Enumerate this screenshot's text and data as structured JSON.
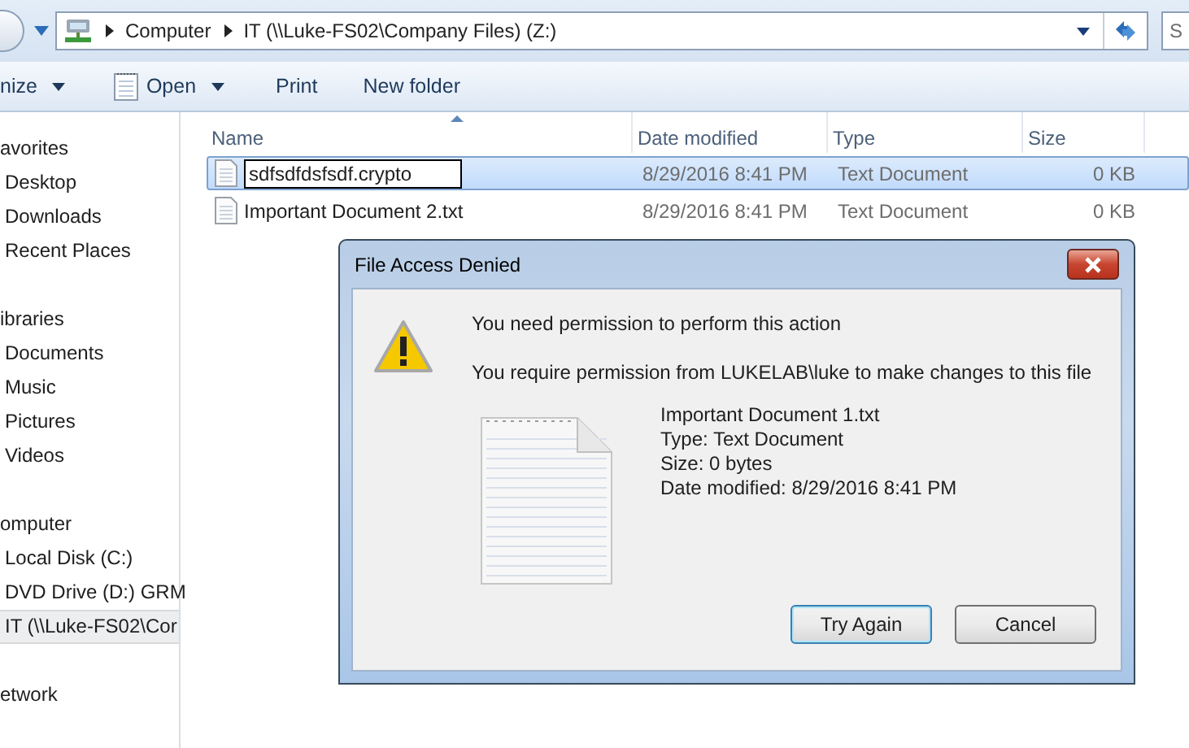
{
  "address_bar": {
    "path": [
      {
        "label": "Computer"
      },
      {
        "label": "IT (\\\\Luke-FS02\\Company Files) (Z:)"
      }
    ],
    "search_placeholder": "S"
  },
  "toolbar": [
    {
      "label": "nize",
      "dropdown": true
    },
    {
      "label": "Open",
      "dropdown": true,
      "kind": "icon"
    },
    {
      "label": "Print",
      "dropdown": false
    },
    {
      "label": "New folder",
      "dropdown": false
    }
  ],
  "sidebar": {
    "groups": [
      {
        "label": "avorites",
        "items": [
          {
            "label": "Desktop",
            "selected": false
          },
          {
            "label": "Downloads",
            "selected": false
          },
          {
            "label": "Recent Places",
            "selected": false
          }
        ]
      },
      {
        "label": "ibraries",
        "items": [
          {
            "label": "Documents",
            "selected": false
          },
          {
            "label": "Music",
            "selected": false
          },
          {
            "label": "Pictures",
            "selected": false
          },
          {
            "label": "Videos",
            "selected": false
          }
        ]
      },
      {
        "label": "omputer",
        "items": [
          {
            "label": "Local Disk (C:)",
            "selected": false
          },
          {
            "label": "DVD Drive (D:) GRM",
            "selected": false
          },
          {
            "label": "IT (\\\\Luke-FS02\\Cor",
            "selected": true
          }
        ]
      },
      {
        "label": "etwork"
      }
    ]
  },
  "file_list": {
    "columns": [
      "Name",
      "Date modified",
      "Type",
      "Size"
    ],
    "rows": [
      {
        "name": "sdfsdfdsfsdf.crypto",
        "date": "8/29/2016 8:41 PM",
        "type": "Text Document",
        "size": "0 KB",
        "selected": true,
        "renaming": true
      },
      {
        "name": "Important Document 2.txt",
        "date": "8/29/2016 8:41 PM",
        "type": "Text Document",
        "size": "0 KB",
        "selected": false,
        "renaming": false
      }
    ]
  },
  "dialog": {
    "title": "File Access Denied",
    "heading": "You need permission to perform this action",
    "message": "You require permission from LUKELAB\\luke to make changes to this file",
    "file": {
      "name": "Important Document 1.txt",
      "type": "Type: Text Document",
      "size": "Size: 0 bytes",
      "date": "Date modified: 8/29/2016 8:41 PM"
    },
    "buttons": [
      {
        "label": "Try Again",
        "default": true
      },
      {
        "label": "Cancel",
        "default": false
      }
    ]
  }
}
